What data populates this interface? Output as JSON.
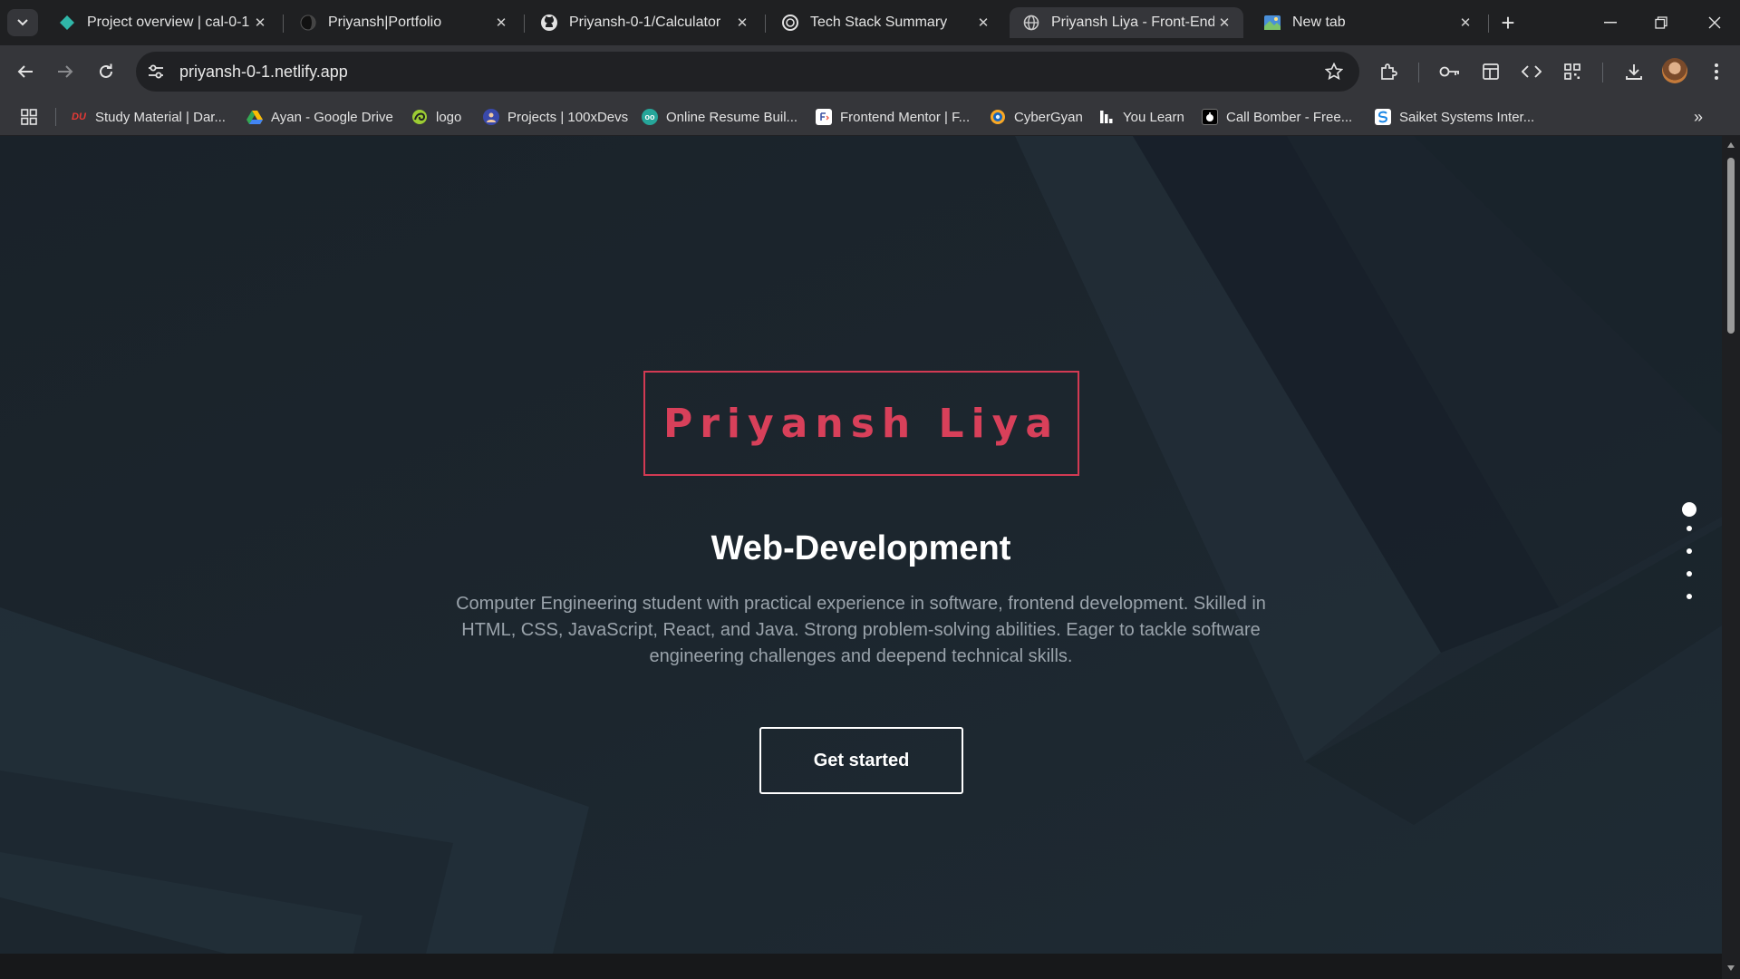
{
  "browser": {
    "tabs": [
      {
        "title": "Project overview | cal-0-1 |",
        "favicon": "netlify-diamond-icon",
        "active": false
      },
      {
        "title": "Priyansh|Portfolio",
        "favicon": "dark-circle-icon",
        "active": false
      },
      {
        "title": "Priyansh-0-1/Calculator",
        "favicon": "github-icon",
        "active": false
      },
      {
        "title": "Tech Stack Summary",
        "favicon": "openai-icon",
        "active": false
      },
      {
        "title": "Priyansh Liya - Front-End &",
        "favicon": "globe-icon",
        "active": true
      },
      {
        "title": "New tab",
        "favicon": "chrome-newtab-icon",
        "active": false
      }
    ],
    "url": "priyansh-0-1.netlify.app",
    "bookmarks": [
      {
        "label": "Study Material | Dar...",
        "icon": "du-icon",
        "color": "#e53935"
      },
      {
        "label": "Ayan - Google Drive",
        "icon": "google-drive-icon",
        "color": "#34a853"
      },
      {
        "label": "logo",
        "icon": "logo-swirl-icon",
        "color": "#9ccc33"
      },
      {
        "label": "Projects | 100xDevs",
        "icon": "100xdevs-icon",
        "color": "#3949ab"
      },
      {
        "label": "Online Resume Buil...",
        "icon": "resume-icon",
        "color": "#26a69a"
      },
      {
        "label": "Frontend Mentor | F...",
        "icon": "frontend-mentor-icon",
        "color": "#ffffff"
      },
      {
        "label": "CyberGyan",
        "icon": "cybergyan-icon",
        "color": "#f9a825"
      },
      {
        "label": "You Learn",
        "icon": "you-learn-icon",
        "color": "#ffffff"
      },
      {
        "label": "Call Bomber - Free...",
        "icon": "call-bomber-icon",
        "color": "#000000"
      },
      {
        "label": "Saiket Systems Inter...",
        "icon": "saiket-icon",
        "color": "#1e88e5"
      }
    ]
  },
  "page": {
    "name": "Priyansh Liya",
    "role": "Web-Development",
    "description": "Computer Engineering student with practical experience in software, frontend development. Skilled in HTML, CSS, JavaScript, React, and Java. Strong problem-solving abilities. Eager to tackle software engineering challenges and deepend technical skills.",
    "cta_label": "Get started",
    "section_dots": 5,
    "active_dot": 0
  },
  "colors": {
    "accent": "#d8405a",
    "page_bg": "#1e2830",
    "chrome_bg": "#35363a"
  }
}
